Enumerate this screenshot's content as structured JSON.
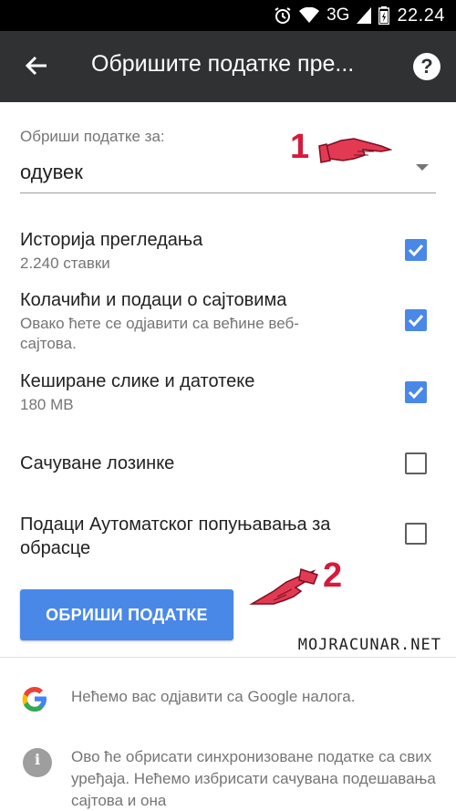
{
  "status_bar": {
    "network": "3G",
    "time": "22.24"
  },
  "app_bar": {
    "title": "Обришите податке пре..."
  },
  "clear_for": {
    "label": "Обриши податке за:",
    "value": "одувек"
  },
  "options": [
    {
      "title": "Историја прегледања",
      "subtitle": "2.240 ставки",
      "checked": true
    },
    {
      "title": "Колачићи и подаци о сајтовима",
      "subtitle": "Овако ћете се одјавити са већине веб-сајтова.",
      "checked": true
    },
    {
      "title": "Кеширане слике и датотеке",
      "subtitle": "180 MB",
      "checked": true
    },
    {
      "title": "Сачуване лозинке",
      "subtitle": "",
      "checked": false
    },
    {
      "title": "Подаци Аутоматског попуњавања за обрасце",
      "subtitle": "",
      "checked": false
    }
  ],
  "clear_button": {
    "label": "ОБРИШИ ПОДАТКЕ"
  },
  "annotations": {
    "step1": "1",
    "step2": "2",
    "watermark": "MOJRACUNAR.NET"
  },
  "footer": [
    {
      "icon": "google-g-icon",
      "text": "Нећемо вас одјавити са Google налога."
    },
    {
      "icon": "info-icon",
      "text": "Ово ће обрисати синхронизоване податке са свих уређаја. Нећемо избрисати сачувана подешавања сајтова и она"
    }
  ],
  "colors": {
    "accent": "#4a88e8",
    "app_bar": "#2f3133",
    "annotation": "#d71a3b"
  }
}
